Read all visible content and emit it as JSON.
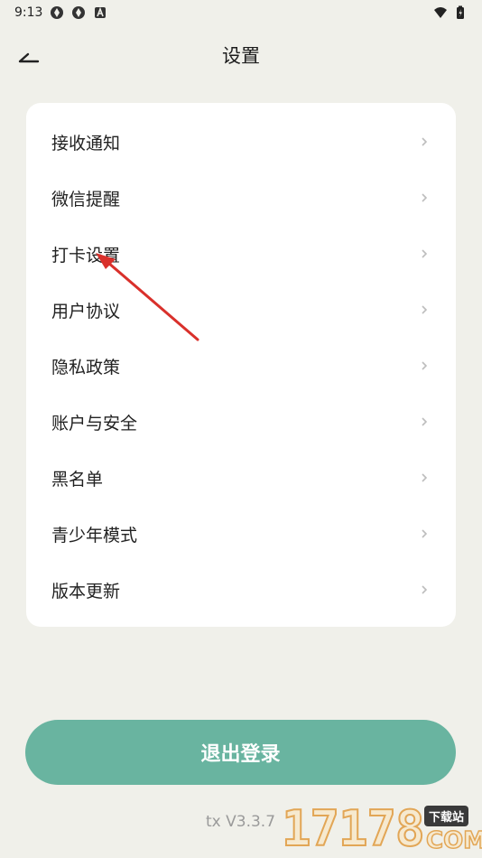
{
  "status_bar": {
    "time": "9:13"
  },
  "header": {
    "title": "设置"
  },
  "menu": {
    "items": [
      {
        "label": "接收通知"
      },
      {
        "label": "微信提醒"
      },
      {
        "label": "打卡设置"
      },
      {
        "label": "用户协议"
      },
      {
        "label": "隐私政策"
      },
      {
        "label": "账户与安全"
      },
      {
        "label": "黑名单"
      },
      {
        "label": "青少年模式"
      },
      {
        "label": "版本更新"
      }
    ]
  },
  "logout": {
    "label": "退出登录"
  },
  "footer": {
    "version": "tx V3.3.7"
  },
  "watermark": {
    "number": "17178",
    "tag": "下载站",
    "domain": "COM"
  },
  "colors": {
    "background": "#f0f0ea",
    "card": "#ffffff",
    "accent": "#69b4a0",
    "annotation_arrow": "#d9302b"
  }
}
